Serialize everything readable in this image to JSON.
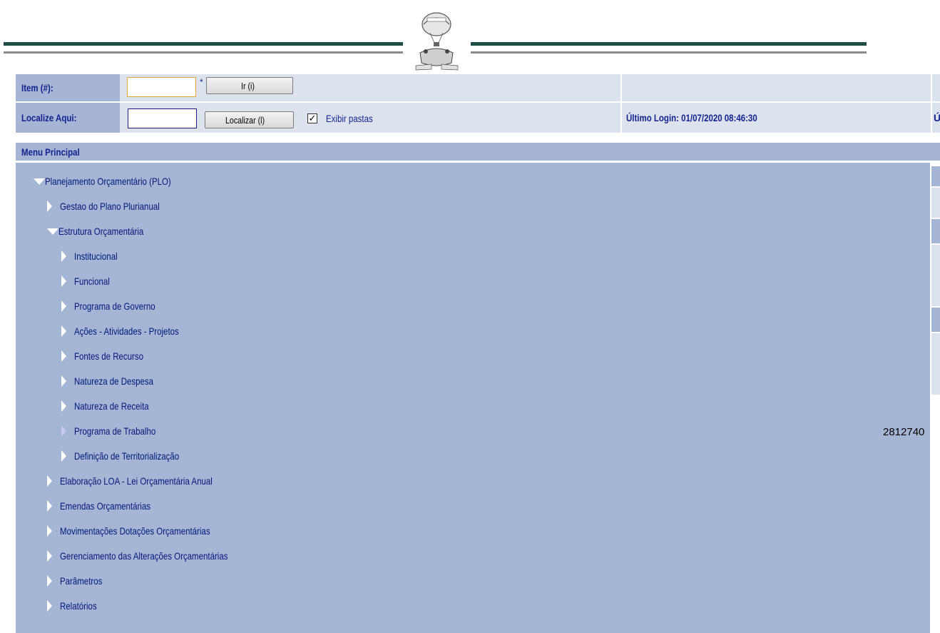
{
  "form": {
    "item_label": "Item (#):",
    "item_value": "",
    "required_marker": "*",
    "go_button": "Ir (i)",
    "locate_label": "Localize Aqui:",
    "locate_value": "",
    "locate_button": "Localizar (l)",
    "show_folders_checked": "✓",
    "show_folders_label": "Exibir pastas",
    "last_login": "Último Login: 01/07/2020 08:46:30",
    "last_login_cut": "Ú"
  },
  "menu": {
    "title": "Menu Principal",
    "items": [
      {
        "label": "Planejamento Orçamentário (PLO)",
        "state": "expanded"
      },
      {
        "label": "Gestao do Plano Plurianual",
        "state": "collapsed"
      },
      {
        "label": "Estrutura Orçamentária",
        "state": "expanded"
      },
      {
        "label": "Institucional",
        "state": "collapsed"
      },
      {
        "label": "Funcional",
        "state": "collapsed"
      },
      {
        "label": "Programa de Governo",
        "state": "collapsed"
      },
      {
        "label": "Ações - Atividades - Projetos",
        "state": "collapsed"
      },
      {
        "label": "Fontes de Recurso",
        "state": "collapsed"
      },
      {
        "label": "Natureza de Despesa",
        "state": "collapsed"
      },
      {
        "label": "Natureza de Receita",
        "state": "collapsed"
      },
      {
        "label": "Programa de Trabalho",
        "state": "collapsed-dim"
      },
      {
        "label": "Definição de Territorialização",
        "state": "collapsed"
      },
      {
        "label": "Elaboração LOA - Lei Orçamentária Anual",
        "state": "collapsed"
      },
      {
        "label": "Emendas Orçamentárias",
        "state": "collapsed"
      },
      {
        "label": "Movimentações Dotações Orçamentárias",
        "state": "collapsed"
      },
      {
        "label": "Gerenciamento das Alterações Orçamentárias",
        "state": "collapsed"
      },
      {
        "label": "Parâmetros",
        "state": "collapsed"
      },
      {
        "label": "Relatórios",
        "state": "collapsed"
      }
    ]
  },
  "stray_number": "2812740",
  "colors": {
    "label_bg": "#a5b5d3",
    "label_text": "#12238f",
    "row_bg": "#dde3ee",
    "menu_bg": "#a5b6d4",
    "menu_text": "#05147a",
    "header_line": "#1f4e47"
  }
}
